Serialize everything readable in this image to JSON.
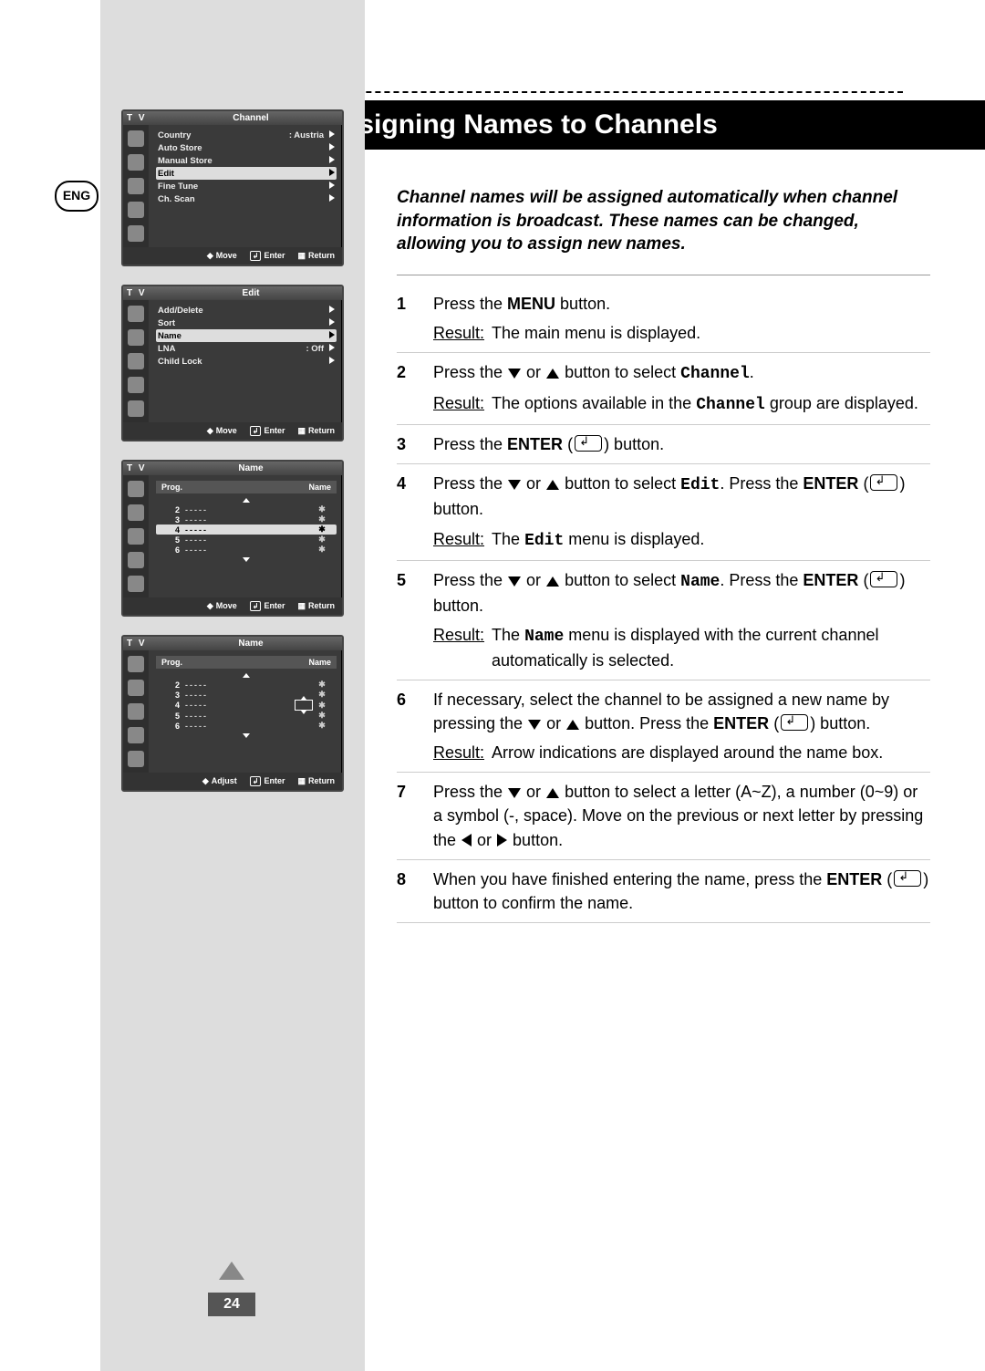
{
  "lang_badge": "ENG",
  "title": "Assigning Names to Channels",
  "intro": "Channel names will be assigned automatically when channel information is broadcast. These names can be changed, allowing you to assign new names.",
  "page_number": "24",
  "result_label": "Result:",
  "steps": [
    {
      "num": "1",
      "text_parts": [
        "Press the ",
        {
          "b": "MENU"
        },
        " button."
      ],
      "result": "The main menu is displayed."
    },
    {
      "num": "2",
      "text_parts": [
        "Press the ",
        {
          "icon": "down"
        },
        " or ",
        {
          "icon": "up"
        },
        " button to select ",
        {
          "mono": "Channel"
        },
        "."
      ],
      "result_parts": [
        "The options available in the ",
        {
          "mono": "Channel"
        },
        " group are displayed."
      ]
    },
    {
      "num": "3",
      "text_parts": [
        "Press the ",
        {
          "b": "ENTER"
        },
        " (",
        {
          "icon": "enter"
        },
        ") button."
      ]
    },
    {
      "num": "4",
      "text_parts": [
        "Press the ",
        {
          "icon": "down"
        },
        " or ",
        {
          "icon": "up"
        },
        " button to select ",
        {
          "mono": "Edit"
        },
        ". Press the ",
        {
          "b": "ENTER"
        },
        " (",
        {
          "icon": "enter"
        },
        ") button."
      ],
      "result_parts": [
        "The ",
        {
          "mono": "Edit"
        },
        " menu is displayed."
      ]
    },
    {
      "num": "5",
      "text_parts": [
        "Press the ",
        {
          "icon": "down"
        },
        " or ",
        {
          "icon": "up"
        },
        " button to select ",
        {
          "mono": "Name"
        },
        ". Press the ",
        {
          "b": "ENTER"
        },
        " (",
        {
          "icon": "enter"
        },
        ") button."
      ],
      "result_parts": [
        "The ",
        {
          "mono": "Name"
        },
        " menu is displayed with the current channel automatically is selected."
      ]
    },
    {
      "num": "6",
      "text_parts": [
        "If necessary, select the channel to be assigned a new name by pressing the ",
        {
          "icon": "down"
        },
        " or ",
        {
          "icon": "up"
        },
        " button. Press the ",
        {
          "b": "ENTER"
        },
        " (",
        {
          "icon": "enter"
        },
        ") button."
      ],
      "result": "Arrow indications are displayed around the name box."
    },
    {
      "num": "7",
      "text_parts": [
        "Press the ",
        {
          "icon": "down"
        },
        " or ",
        {
          "icon": "up"
        },
        " button to select a letter (A~Z), a number (0~9) or a symbol (-, space). Move on the previous or next letter by pressing the ",
        {
          "icon": "left"
        },
        " or ",
        {
          "icon": "right"
        },
        " button."
      ]
    },
    {
      "num": "8",
      "text_parts": [
        "When you have finished entering the name, press the ",
        {
          "b": "ENTER"
        },
        " (",
        {
          "icon": "enter"
        },
        ") button to confirm the name."
      ]
    }
  ],
  "osd": {
    "tv_label": "T V",
    "foot": {
      "move": "Move",
      "enter": "Enter",
      "return": "Return",
      "adjust": "Adjust"
    },
    "screen1": {
      "title": "Channel",
      "rows": [
        {
          "label": "Country",
          "value": ": Austria",
          "arrow": true
        },
        {
          "label": "Auto Store",
          "arrow": true
        },
        {
          "label": "Manual Store",
          "arrow": true
        },
        {
          "label": "Edit",
          "arrow": true,
          "selected": true
        },
        {
          "label": "Fine Tune",
          "arrow": true
        },
        {
          "label": "Ch. Scan",
          "arrow": true
        }
      ]
    },
    "screen2": {
      "title": "Edit",
      "rows": [
        {
          "label": "Add/Delete",
          "arrow": true
        },
        {
          "label": "Sort",
          "arrow": true
        },
        {
          "label": "Name",
          "arrow": true,
          "selected": true
        },
        {
          "label": "LNA",
          "value": ": Off",
          "arrow": true
        },
        {
          "label": "Child Lock",
          "arrow": true
        }
      ]
    },
    "screen3": {
      "title": "Name",
      "header": {
        "c1": "Prog.",
        "c2": "Name"
      },
      "rows": [
        {
          "prog": "2",
          "dash": "-----",
          "star": "✱"
        },
        {
          "prog": "3",
          "dash": "-----",
          "star": "✱"
        },
        {
          "prog": "4",
          "dash": "-----",
          "star": "✱",
          "selected": true
        },
        {
          "prog": "5",
          "dash": "-----",
          "star": "✱"
        },
        {
          "prog": "6",
          "dash": "-----",
          "star": "✱"
        }
      ],
      "foot_mode": "move"
    },
    "screen4": {
      "title": "Name",
      "header": {
        "c1": "Prog.",
        "c2": "Name"
      },
      "rows": [
        {
          "prog": "2",
          "dash": "-----",
          "star": "✱"
        },
        {
          "prog": "3",
          "dash": "-----",
          "star": "✱"
        },
        {
          "prog": "4",
          "dash": "-----",
          "star": "✱",
          "namebox": true
        },
        {
          "prog": "5",
          "dash": "-----",
          "star": "✱"
        },
        {
          "prog": "6",
          "dash": "-----",
          "star": "✱"
        }
      ],
      "foot_mode": "adjust"
    }
  }
}
